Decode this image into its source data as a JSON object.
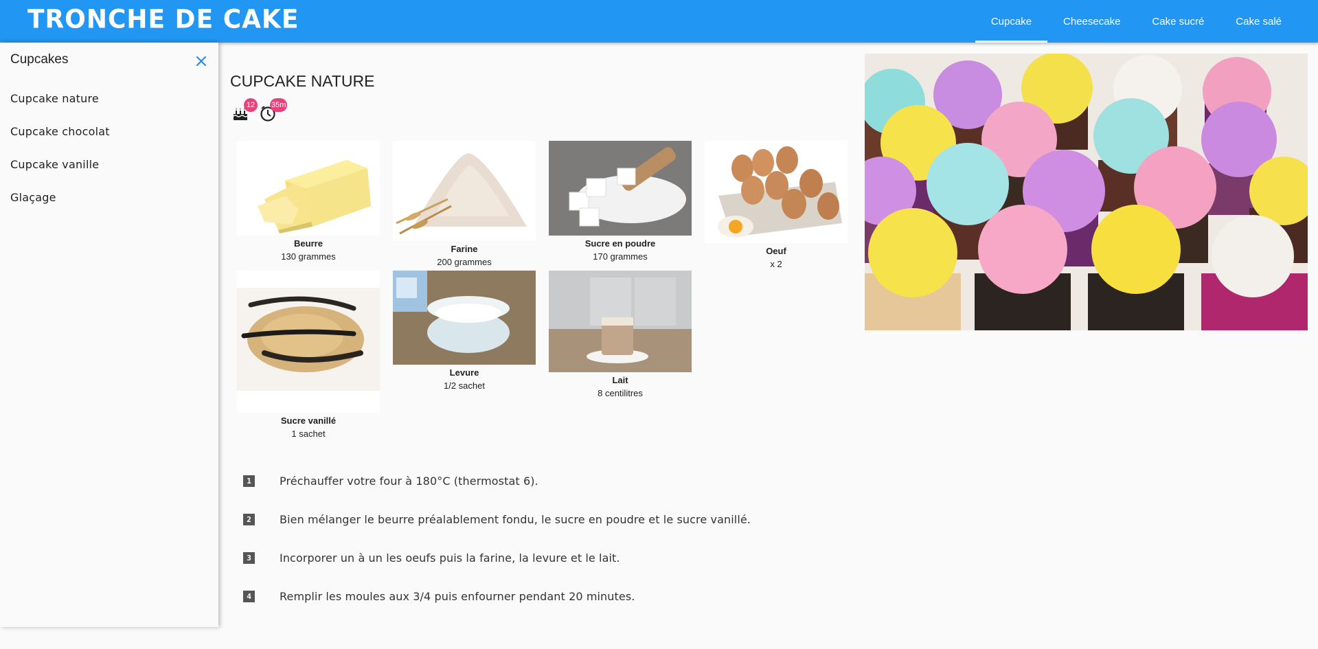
{
  "header": {
    "logo": "TRONCHE DE CAKE",
    "tabs": [
      {
        "label": "Cupcake",
        "active": true
      },
      {
        "label": "Cheesecake",
        "active": false
      },
      {
        "label": "Cake sucré",
        "active": false
      },
      {
        "label": "Cake salé",
        "active": false
      }
    ]
  },
  "sidebar": {
    "title": "Cupcakes",
    "items": [
      "Cupcake nature",
      "Cupcake chocolat",
      "Cupcake vanille",
      "Glaçage"
    ]
  },
  "recipe": {
    "title": "CUPCAKE NATURE",
    "servings_badge": "12",
    "time_badge": "35m",
    "ingredients": [
      {
        "name": "Beurre",
        "quantity": "130 grammes",
        "icon": "butter-image"
      },
      {
        "name": "Farine",
        "quantity": "200 grammes",
        "icon": "flour-image"
      },
      {
        "name": "Sucre en poudre",
        "quantity": "170 grammes",
        "icon": "sugar-image"
      },
      {
        "name": "Oeuf",
        "quantity": "x 2",
        "icon": "eggs-image"
      },
      {
        "name": "Sucre vanillé",
        "quantity": "1 sachet",
        "icon": "vanilla-image"
      },
      {
        "name": "Levure",
        "quantity": "1/2 sachet",
        "icon": "baking-powder-image"
      },
      {
        "name": "Lait",
        "quantity": "8 centilitres",
        "icon": "milk-image"
      }
    ],
    "steps": [
      {
        "num": "1",
        "text": "Préchauffer votre four à 180°C (thermostat 6)."
      },
      {
        "num": "2",
        "text": "Bien mélanger le beurre préalablement fondu, le sucre en poudre et le sucre vanillé."
      },
      {
        "num": "3",
        "text": "Incorporer un à un les oeufs puis la farine, la levure et le lait."
      },
      {
        "num": "4",
        "text": "Remplir les moules aux 3/4 puis enfourner pendant 20 minutes."
      }
    ]
  },
  "colors": {
    "primary": "#2196f3",
    "badge": "#ec407a",
    "close_icon": "#1e88e5"
  }
}
